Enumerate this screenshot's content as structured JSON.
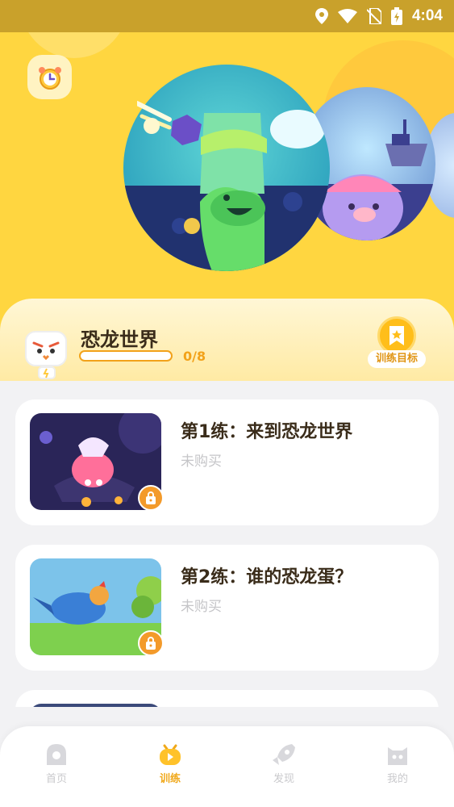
{
  "status_bar": {
    "time": "4:04"
  },
  "header": {
    "alarm_icon": "alarm-clock-icon"
  },
  "course": {
    "title": "恐龙世界",
    "progress_text": "0/8",
    "progress_fraction": 0,
    "goal_label": "训练目标"
  },
  "lessons": [
    {
      "title": "第1练：来到恐龙世界",
      "status": "未购买"
    },
    {
      "title": "第2练：谁的恐龙蛋？",
      "status": "未购买"
    }
  ],
  "tabbar": {
    "tabs": [
      {
        "label": "首页",
        "icon": "home-icon"
      },
      {
        "label": "训练",
        "icon": "training-icon",
        "active": true
      },
      {
        "label": "发现",
        "icon": "rocket-icon"
      },
      {
        "label": "我的",
        "icon": "profile-icon"
      }
    ]
  },
  "colors": {
    "hero_bg": "#ffd640",
    "accent": "#f2a21a",
    "lock": "#f39a2a"
  }
}
